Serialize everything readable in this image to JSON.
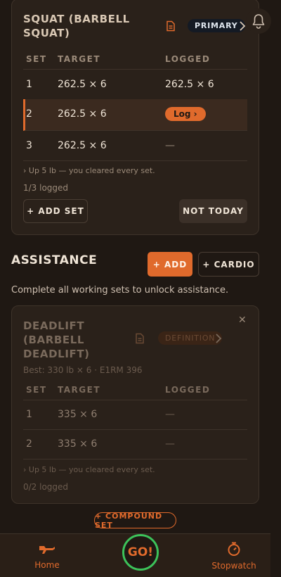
{
  "primary_exercise": {
    "title": "SQUAT (BARBELL SQUAT)",
    "badge": "PRIMARY",
    "columns": [
      "SET",
      "TARGET",
      "LOGGED"
    ],
    "rows": [
      {
        "set": "1",
        "target": "262.5 × 6",
        "logged": "262.5 × 6"
      },
      {
        "set": "2",
        "target": "262.5 × 6",
        "logged": "Log ›"
      },
      {
        "set": "3",
        "target": "262.5 × 6",
        "logged": "—"
      }
    ],
    "hint": "›  Up 5 lb — you cleared every set.",
    "logged_count": "1/3 logged",
    "add_set_label": "+ ADD SET",
    "not_today_label": "NOT TODAY"
  },
  "assistance": {
    "title": "ASSISTANCE",
    "add_label": "+ ADD",
    "cardio_label": "+ CARDIO",
    "unlock_message": "Complete all working sets to unlock assistance."
  },
  "assistance_exercise": {
    "title": "DEADLIFT (BARBELL DEADLIFT)",
    "badge": "DEFINITION",
    "close_glyph": "✕",
    "best": "Best: 330 lb × 6 · E1RM 396",
    "columns": [
      "SET",
      "TARGET",
      "LOGGED"
    ],
    "rows": [
      {
        "set": "1",
        "target": "335 × 6",
        "logged": "—"
      },
      {
        "set": "2",
        "target": "335 × 6",
        "logged": "—"
      }
    ],
    "hint": "›  Up 5 lb — you cleared every set.",
    "logged_count": "0/2 logged"
  },
  "compound_set_label": "+ COMPOUND SET",
  "nav": {
    "home": "Home",
    "go": "GO!",
    "stopwatch": "Stopwatch"
  },
  "colors": {
    "accent": "#e06a2c",
    "go_ring": "#3cc25a",
    "background": "#1f1813"
  }
}
